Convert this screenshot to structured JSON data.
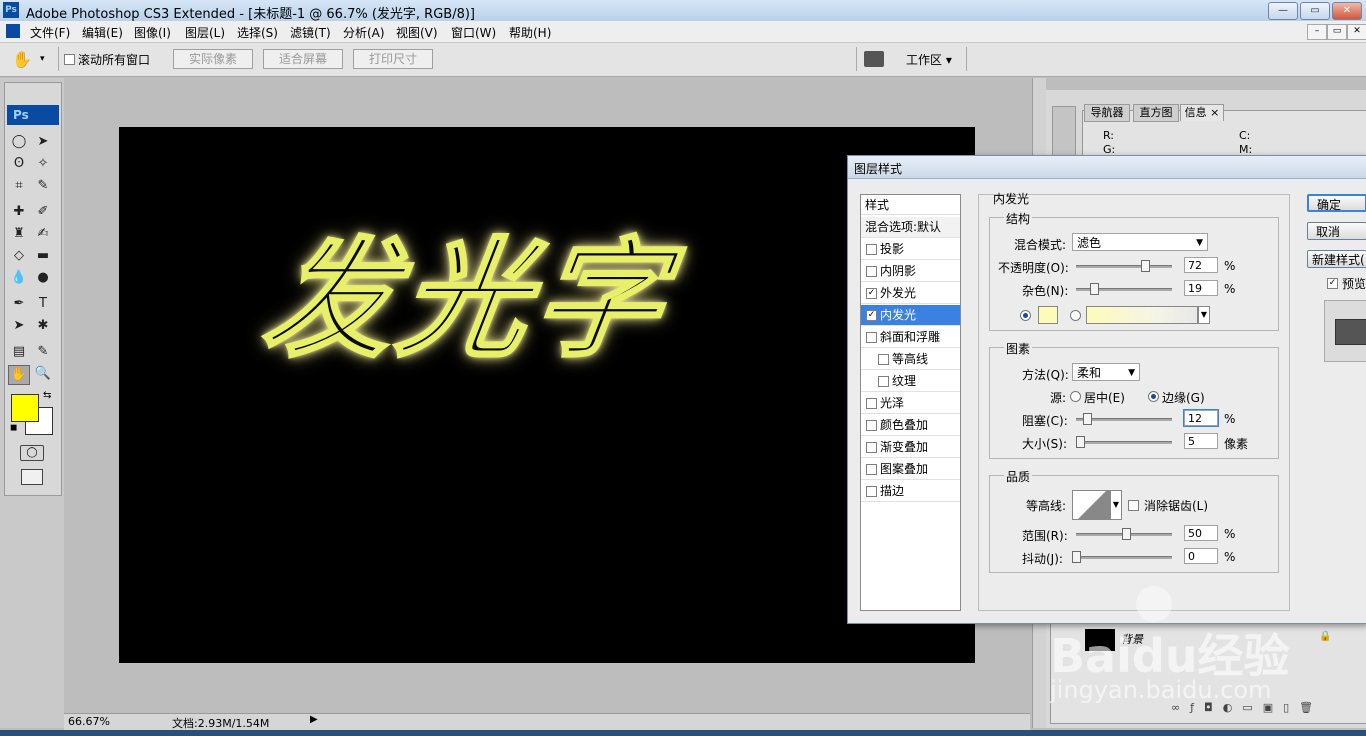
{
  "window": {
    "title": "Adobe Photoshop CS3 Extended - [未标题-1 @ 66.7% (发光字, RGB/8)]",
    "app_icon_text": "Ps",
    "buttons": {
      "minimize": "—",
      "restore": "▭",
      "close": "✕"
    }
  },
  "menu": {
    "items": [
      "文件(F)",
      "编辑(E)",
      "图像(I)",
      "图层(L)",
      "选择(S)",
      "滤镜(T)",
      "分析(A)",
      "视图(V)",
      "窗口(W)",
      "帮助(H)"
    ]
  },
  "options": {
    "scroll_all_label": "滚动所有窗口",
    "btn_actual": "实际像素",
    "btn_fit": "适合屏幕",
    "btn_print": "打印尺寸",
    "workspace": "工作区 ▾"
  },
  "toolbox": {
    "logo": "Ps",
    "fg_color": "#ffff00",
    "bg_color": "#ffffff"
  },
  "canvas": {
    "text": "发光字",
    "bg_color": "#000000"
  },
  "status": {
    "zoom": "66.67%",
    "doc": "文档:2.93M/1.54M"
  },
  "panels": {
    "tabs": [
      "导航器",
      "直方图",
      "信息"
    ],
    "info": {
      "r": "R:",
      "g": "G:",
      "c": "C:",
      "m": "M:"
    },
    "layer_name": "背景"
  },
  "dialog": {
    "title": "图层样式",
    "styles_header": "样式",
    "blend_default": "混合选项:默认",
    "items": [
      {
        "label": "投影",
        "checked": false,
        "indent": false,
        "selected": false
      },
      {
        "label": "内阴影",
        "checked": false,
        "indent": false,
        "selected": false
      },
      {
        "label": "外发光",
        "checked": true,
        "indent": false,
        "selected": false
      },
      {
        "label": "内发光",
        "checked": true,
        "indent": false,
        "selected": true
      },
      {
        "label": "斜面和浮雕",
        "checked": false,
        "indent": false,
        "selected": false
      },
      {
        "label": "等高线",
        "checked": false,
        "indent": true,
        "selected": false
      },
      {
        "label": "纹理",
        "checked": false,
        "indent": true,
        "selected": false
      },
      {
        "label": "光泽",
        "checked": false,
        "indent": false,
        "selected": false
      },
      {
        "label": "颜色叠加",
        "checked": false,
        "indent": false,
        "selected": false
      },
      {
        "label": "渐变叠加",
        "checked": false,
        "indent": false,
        "selected": false
      },
      {
        "label": "图案叠加",
        "checked": false,
        "indent": false,
        "selected": false
      },
      {
        "label": "描边",
        "checked": false,
        "indent": false,
        "selected": false
      }
    ],
    "section_title": "内发光",
    "structure": {
      "title": "结构",
      "blend_mode_label": "混合模式:",
      "blend_mode_value": "滤色",
      "opacity_label": "不透明度(O):",
      "opacity_value": "72",
      "noise_label": "杂色(N):",
      "noise_value": "19",
      "percent": "%",
      "glow_color": "#fdfbb8"
    },
    "elements": {
      "title": "图素",
      "method_label": "方法(Q):",
      "method_value": "柔和",
      "source_label": "源:",
      "center_label": "居中(E)",
      "edge_label": "边缘(G)",
      "choke_label": "阻塞(C):",
      "choke_value": "12",
      "size_label": "大小(S):",
      "size_value": "5",
      "px_unit": "像素",
      "percent": "%"
    },
    "quality": {
      "title": "品质",
      "contour_label": "等高线:",
      "antialias_label": "消除锯齿(L)",
      "range_label": "范围(R):",
      "range_value": "50",
      "jitter_label": "抖动(J):",
      "jitter_value": "0",
      "percent": "%"
    },
    "buttons": {
      "ok": "确定",
      "cancel": "取消",
      "new_style": "新建样式(",
      "preview": "预览"
    }
  },
  "watermark": {
    "brand": "Baidu经验",
    "url": "jingyan.baidu.com"
  }
}
